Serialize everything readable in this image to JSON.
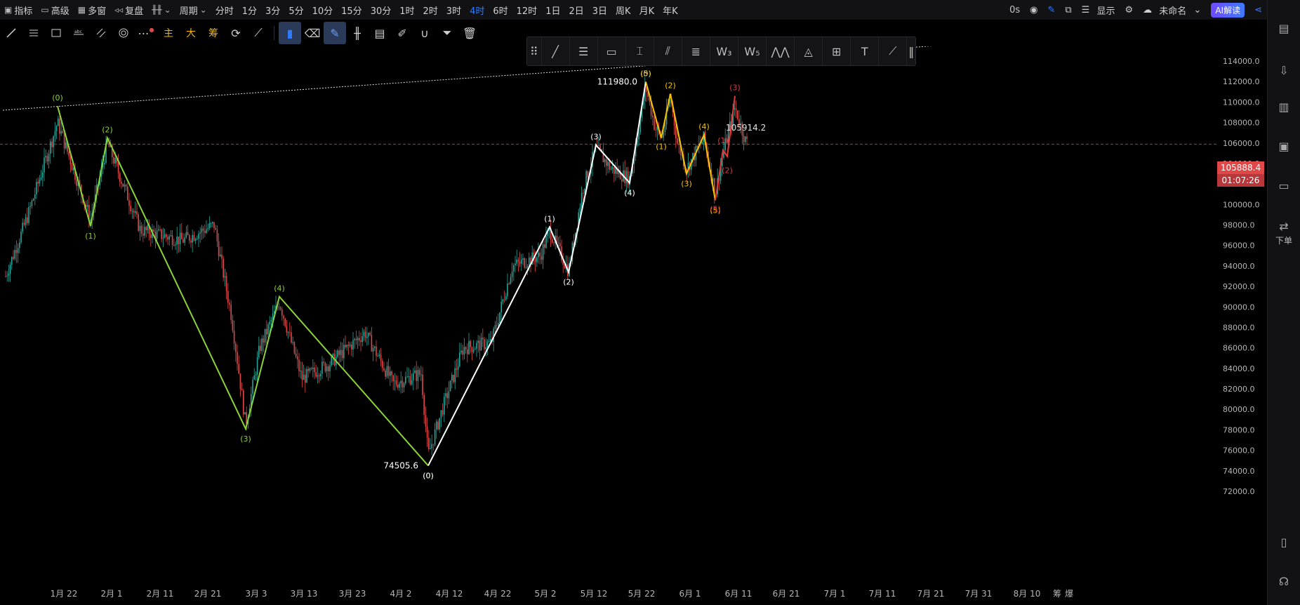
{
  "toolbar": {
    "indicators": "指标",
    "advanced": "高级",
    "multi_window": "多窗",
    "replay": "复盘",
    "chart_type_icon": "candles-icon",
    "period": "周期",
    "periods": [
      "分时",
      "1分",
      "3分",
      "5分",
      "10分",
      "15分",
      "30分",
      "1时",
      "2时",
      "3时",
      "4时",
      "6时",
      "12时",
      "1日",
      "2日",
      "3日",
      "周K",
      "月K",
      "年K"
    ],
    "active_period": "4时",
    "timer": "0s",
    "display": "显示",
    "layout_name": "未命名",
    "ai_button": "AI解读"
  },
  "drawbar": {
    "main_label": "主",
    "big_label": "大",
    "chips_label": "筹"
  },
  "sidebar": {
    "order_label": "下单"
  },
  "chart_data": {
    "type": "candlestick",
    "current_price": "105888.4",
    "countdown": "01:07:26",
    "high_label": "111980.0",
    "low_label": "74505.6",
    "last_label": "105914.2",
    "y_ticks": [
      "114000.0",
      "112000.0",
      "110000.0",
      "108000.0",
      "106000.0",
      "104000.0",
      "102000.0",
      "100000.0",
      "98000.0",
      "96000.0",
      "94000.0",
      "92000.0",
      "90000.0",
      "88000.0",
      "86000.0",
      "84000.0",
      "82000.0",
      "80000.0",
      "78000.0",
      "76000.0",
      "74000.0",
      "72000.0"
    ],
    "x_ticks": [
      "1月 22",
      "2月 1",
      "2月 11",
      "2月 21",
      "3月 3",
      "3月 13",
      "3月 23",
      "4月 2",
      "4月 12",
      "4月 22",
      "5月 2",
      "5月 12",
      "5月 22",
      "6月 1",
      "6月 11",
      "6月 21",
      "7月 1",
      "7月 11",
      "7月 21",
      "7月 31",
      "8月 10"
    ],
    "bottom_right_labels": [
      "筹",
      "爆"
    ],
    "waves": {
      "green": {
        "color": "#8bd437",
        "points": [
          {
            "label": "(0)",
            "price": 109600
          },
          {
            "label": "(1)",
            "price": 97900
          },
          {
            "label": "(2)",
            "price": 106500
          },
          {
            "label": "(3)",
            "price": 78100
          },
          {
            "label": "(4)",
            "price": 91000
          },
          {
            "label": "(0)",
            "price": 74505.6
          }
        ]
      },
      "white": {
        "color": "#ffffff",
        "points": [
          {
            "label": "(0)",
            "price": 74505.6
          },
          {
            "label": "(1)",
            "price": 97800
          },
          {
            "label": "(2)",
            "price": 93400
          },
          {
            "label": "(3)",
            "price": 105800
          },
          {
            "label": "(4)",
            "price": 102100
          },
          {
            "label": "(5)",
            "price": 111980
          }
        ]
      },
      "yellow": {
        "color": "#f5c400",
        "points": [
          {
            "label": "(0)",
            "price": 111980
          },
          {
            "label": "(1)",
            "price": 106500
          },
          {
            "label": "(2)",
            "price": 110800
          },
          {
            "label": "(3)",
            "price": 103000
          },
          {
            "label": "(4)",
            "price": 106800
          },
          {
            "label": "(5)",
            "price": 100400
          }
        ]
      },
      "red": {
        "color": "#e8383b",
        "points": [
          {
            "label": "(5)",
            "price": 100400
          },
          {
            "label": "(1)",
            "price": 105300
          },
          {
            "label": "(2)",
            "price": 104700
          },
          {
            "label": "(3)",
            "price": 110600
          }
        ]
      }
    },
    "colors": {
      "up": "#26a69a",
      "down": "#e04848",
      "trendline": "#dddddd",
      "price_line": "#e04848"
    }
  }
}
